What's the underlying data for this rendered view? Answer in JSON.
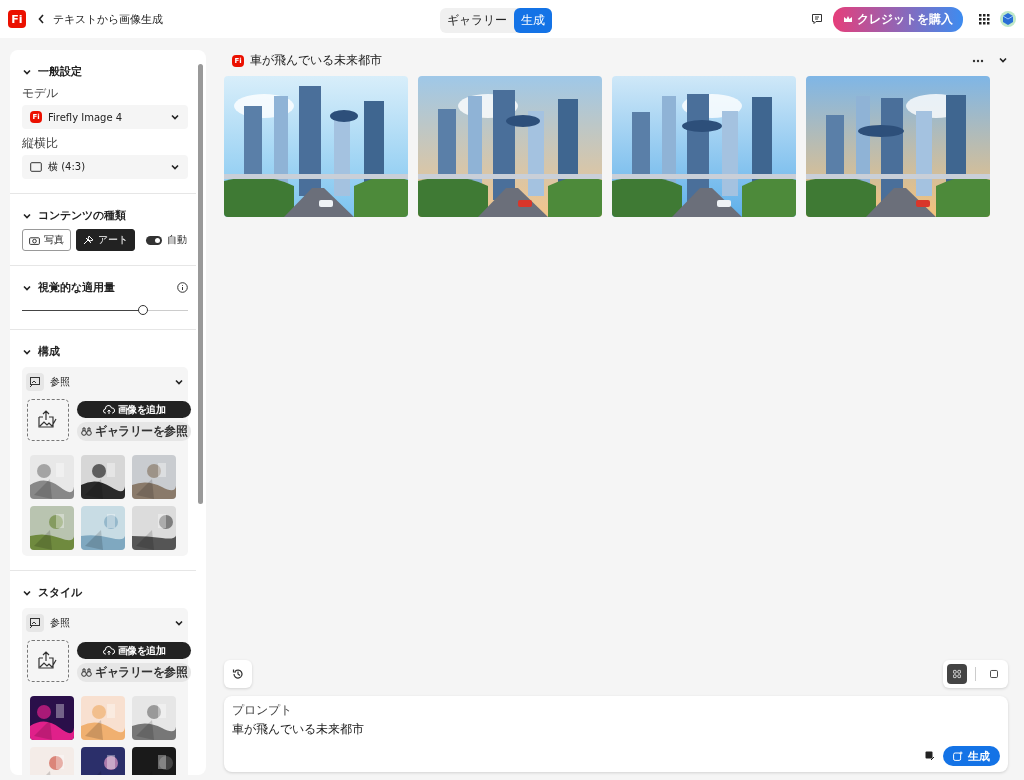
{
  "header": {
    "logo": "Fi",
    "title": "テキストから画像生成",
    "modes": [
      {
        "label": "ギャラリー",
        "selected": false
      },
      {
        "label": "生成",
        "selected": true
      }
    ],
    "buy_credits": "クレジットを購入"
  },
  "sidebar": {
    "general": {
      "title": "一般設定",
      "model_label": "モデル",
      "model_logo": "Fi",
      "model": "Firefly Image 4",
      "aspect_label": "縦横比",
      "aspect": "横 (4:3)"
    },
    "content_type": {
      "title": "コンテンツの種類",
      "options": [
        {
          "label": "写真",
          "selected": false
        },
        {
          "kind": "art",
          "label": "アート",
          "selected": true
        }
      ],
      "auto": {
        "label": "自動",
        "on": true
      }
    },
    "visual_intensity": {
      "title": "視覚的な適用量",
      "level": 0.73
    },
    "composition": {
      "title": "構成",
      "reference": "参照",
      "add_image": "画像を追加",
      "browse": "ギャラリーを参照"
    },
    "style": {
      "title": "スタイル",
      "reference": "参照",
      "add_image": "画像を追加",
      "browse": "ギャラリーを参照"
    }
  },
  "result": {
    "logo": "Fi",
    "title": "車が飛んでいる未来都市"
  },
  "view_toggle": [
    {
      "kind": "grid",
      "selected": true
    },
    {
      "kind": "single",
      "selected": false
    }
  ],
  "prompt": {
    "label": "プロンプト",
    "value": "車が飛んでいる未来都市",
    "generate": "生成"
  }
}
